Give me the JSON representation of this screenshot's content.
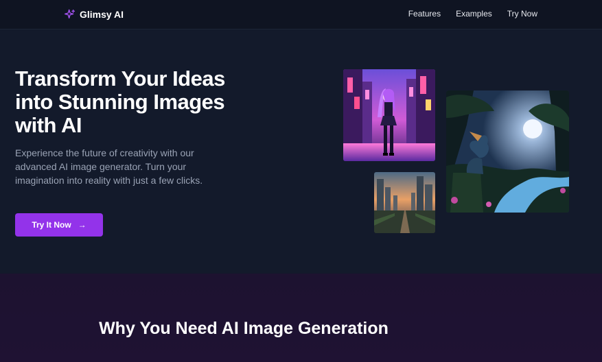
{
  "brand": {
    "name": "Glimsy AI"
  },
  "nav": {
    "links": [
      "Features",
      "Examples",
      "Try Now"
    ]
  },
  "hero": {
    "title": "Transform Your Ideas into Stunning Images with AI",
    "subtitle": "Experience the future of creativity with our advanced AI image generator. Turn your imagination into reality with just a few clicks.",
    "cta_label": "Try It Now"
  },
  "gallery": {
    "images": [
      "anime-girl-neon-city-image",
      "dragon-moonlit-forest-image",
      "futuristic-city-sunset-image"
    ]
  },
  "section2": {
    "title": "Why You Need AI Image Generation"
  },
  "colors": {
    "accent": "#9333ea",
    "background": "#131a2b",
    "section2_bg": "#1d1230"
  }
}
